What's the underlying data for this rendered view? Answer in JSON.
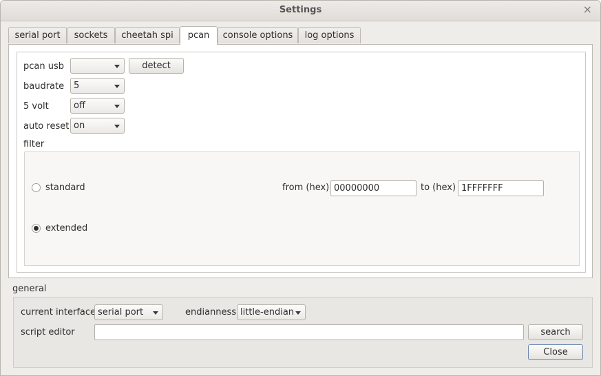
{
  "window": {
    "title": "Settings",
    "close_glyph": "×"
  },
  "tabs": [
    {
      "label": "serial port",
      "active": false
    },
    {
      "label": "sockets",
      "active": false
    },
    {
      "label": "cheetah spi",
      "active": false
    },
    {
      "label": "pcan",
      "active": true
    },
    {
      "label": "console options",
      "active": false
    },
    {
      "label": "log options",
      "active": false
    }
  ],
  "pcan": {
    "usb_label": "pcan usb",
    "usb_value": "",
    "detect_label": "detect",
    "baudrate_label": "baudrate",
    "baudrate_value": "5",
    "five_volt_label": "5 volt",
    "five_volt_value": "off",
    "auto_reset_label": "auto reset",
    "auto_reset_value": "on",
    "filter_label": "filter",
    "filter": {
      "standard_label": "standard",
      "standard_selected": false,
      "extended_label": "extended",
      "extended_selected": true,
      "from_label": "from (hex)",
      "from_value": "00000000",
      "to_label": "to (hex)",
      "to_value": "1FFFFFFF"
    }
  },
  "general": {
    "label": "general",
    "current_interface_label": "current interface",
    "current_interface_value": "serial port",
    "endianness_label": "endianness",
    "endianness_value": "little-endian",
    "script_editor_label": "script editor",
    "script_editor_value": "",
    "search_label": "search",
    "close_label": "Close"
  },
  "icons": {
    "close": "close-icon",
    "combo_arrow": "chevron-down-icon"
  }
}
